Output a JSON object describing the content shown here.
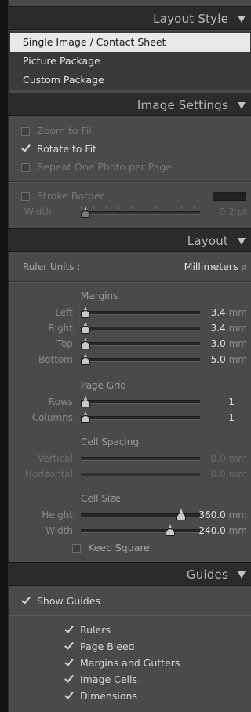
{
  "layout_style": {
    "title": "Layout Style",
    "items": [
      {
        "label": "Single Image / Contact Sheet",
        "selected": true
      },
      {
        "label": "Picture Package",
        "selected": false
      },
      {
        "label": "Custom Package",
        "selected": false
      }
    ]
  },
  "image_settings": {
    "title": "Image Settings",
    "zoom_to_fill": {
      "label": "Zoom to Fill",
      "checked": false
    },
    "rotate_to_fit": {
      "label": "Rotate to Fit",
      "checked": true
    },
    "repeat_one_photo": {
      "label": "Repeat One Photo per Page",
      "checked": false
    },
    "stroke_border": {
      "label": "Stroke Border",
      "checked": false
    },
    "width": {
      "label": "Width",
      "value": "0.2",
      "unit": "pt"
    }
  },
  "layout": {
    "title": "Layout",
    "ruler_units": {
      "label": "Ruler Units :",
      "value": "Millimeters"
    },
    "margins": {
      "heading": "Margins",
      "left": {
        "label": "Left",
        "value": "3.4",
        "unit": "mm",
        "level": 0.0
      },
      "right": {
        "label": "Right",
        "value": "3.4",
        "unit": "mm",
        "level": 0.0
      },
      "top": {
        "label": "Top",
        "value": "3.0",
        "unit": "mm",
        "level": 0.0
      },
      "bottom": {
        "label": "Bottom",
        "value": "5.0",
        "unit": "mm",
        "level": 0.0
      }
    },
    "page_grid": {
      "heading": "Page Grid",
      "rows": {
        "label": "Rows",
        "value": "1",
        "level": 0.0
      },
      "columns": {
        "label": "Columns",
        "value": "1",
        "level": 0.0
      }
    },
    "cell_spacing": {
      "heading": "Cell Spacing",
      "vertical": {
        "label": "Vertical",
        "value": "0.0",
        "unit": "mm"
      },
      "horizontal": {
        "label": "Horizontal",
        "value": "0.0",
        "unit": "mm"
      }
    },
    "cell_size": {
      "heading": "Cell Size",
      "height": {
        "label": "Height",
        "value": "360.0",
        "unit": "mm",
        "level": 0.84
      },
      "width": {
        "label": "Width",
        "value": "240.0",
        "unit": "mm",
        "level": 0.65
      }
    },
    "keep_square": {
      "label": "Keep Square",
      "checked": false
    }
  },
  "guides": {
    "title": "Guides",
    "show_guides": {
      "label": "Show Guides",
      "checked": true
    },
    "items": [
      {
        "label": "Rulers",
        "checked": true
      },
      {
        "label": "Page Bleed",
        "checked": true
      },
      {
        "label": "Margins and Gutters",
        "checked": true
      },
      {
        "label": "Image Cells",
        "checked": true
      },
      {
        "label": "Dimensions",
        "checked": true
      }
    ]
  }
}
